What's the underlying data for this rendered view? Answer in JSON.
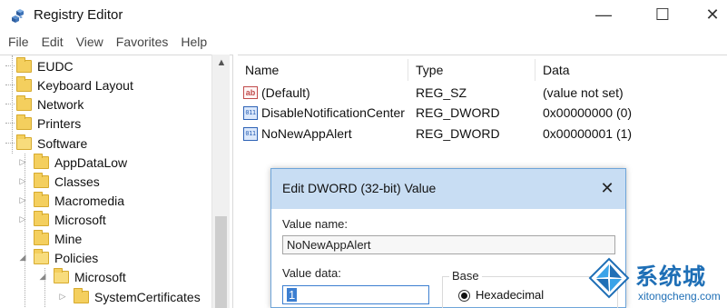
{
  "window": {
    "title": "Registry Editor",
    "icon": "registry-cubes-icon",
    "controls": {
      "minimize": "—",
      "maximize": "☐",
      "close": "✕"
    }
  },
  "menu": [
    "File",
    "Edit",
    "View",
    "Favorites",
    "Help"
  ],
  "tree": {
    "scroll_up": "▲",
    "items": [
      {
        "label": "EUDC",
        "level": 0,
        "expand": ""
      },
      {
        "label": "Keyboard Layout",
        "level": 0,
        "expand": ""
      },
      {
        "label": "Network",
        "level": 0,
        "expand": ""
      },
      {
        "label": "Printers",
        "level": 0,
        "expand": ""
      },
      {
        "label": "Software",
        "level": 0,
        "expand": "expanded"
      },
      {
        "label": "AppDataLow",
        "level": 1,
        "expand": "collapsed"
      },
      {
        "label": "Classes",
        "level": 1,
        "expand": "collapsed"
      },
      {
        "label": "Macromedia",
        "level": 1,
        "expand": "collapsed"
      },
      {
        "label": "Microsoft",
        "level": 1,
        "expand": "collapsed"
      },
      {
        "label": "Mine",
        "level": 1,
        "expand": ""
      },
      {
        "label": "Policies",
        "level": 1,
        "expand": "expanded"
      },
      {
        "label": "Microsoft",
        "level": 2,
        "expand": "expanded"
      },
      {
        "label": "SystemCertificates",
        "level": 3,
        "expand": "collapsed"
      }
    ],
    "expand_glyphs": {
      "collapsed": "▷",
      "expanded": "◢"
    }
  },
  "list": {
    "columns": [
      "Name",
      "Type",
      "Data"
    ],
    "rows": [
      {
        "icon": "string-value-icon",
        "icon_text": "ab",
        "name": "(Default)",
        "type": "REG_SZ",
        "data": "(value not set)"
      },
      {
        "icon": "dword-value-icon",
        "icon_text": "011\n110",
        "name": "DisableNotificationCenter",
        "type": "REG_DWORD",
        "data": "0x00000000 (0)"
      },
      {
        "icon": "dword-value-icon",
        "icon_text": "011\n110",
        "name": "NoNewAppAlert",
        "type": "REG_DWORD",
        "data": "0x00000001 (1)"
      }
    ]
  },
  "dialog": {
    "title": "Edit DWORD (32-bit) Value",
    "close": "✕",
    "value_name_label": "Value name:",
    "value_name": "NoNewAppAlert",
    "value_data_label": "Value data:",
    "value_data": "1",
    "base_label": "Base",
    "base_option": "Hexadecimal",
    "base_selected": true
  },
  "watermark": {
    "brand": "系统城",
    "url": "xitongcheng.com",
    "logo": "windows-diamond-logo"
  },
  "colors": {
    "folder": "#f4cf5e",
    "dialog_title_bg": "#c8ddf3",
    "selection": "#3c7fd1",
    "watermark": "#1f6fb6"
  }
}
